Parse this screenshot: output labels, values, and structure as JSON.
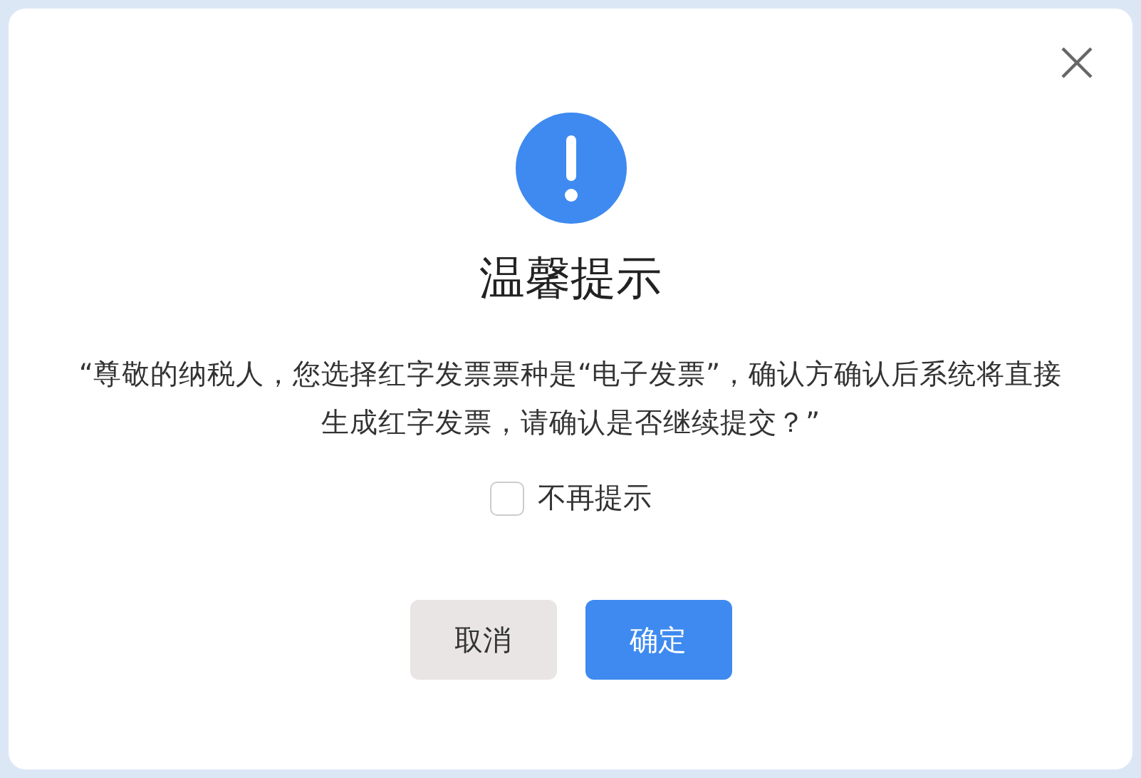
{
  "dialog": {
    "title": "温馨提示",
    "message": "“尊敬的纳税人，您选择红字发票票种是“电子发票”，确认方确认后系统将直接生成红字发票，请确认是否继续提交？”",
    "checkbox": {
      "label": "不再提示",
      "checked": false
    },
    "buttons": [
      {
        "label": "取消",
        "kind": "secondary"
      },
      {
        "label": "确定",
        "kind": "primary"
      }
    ]
  }
}
